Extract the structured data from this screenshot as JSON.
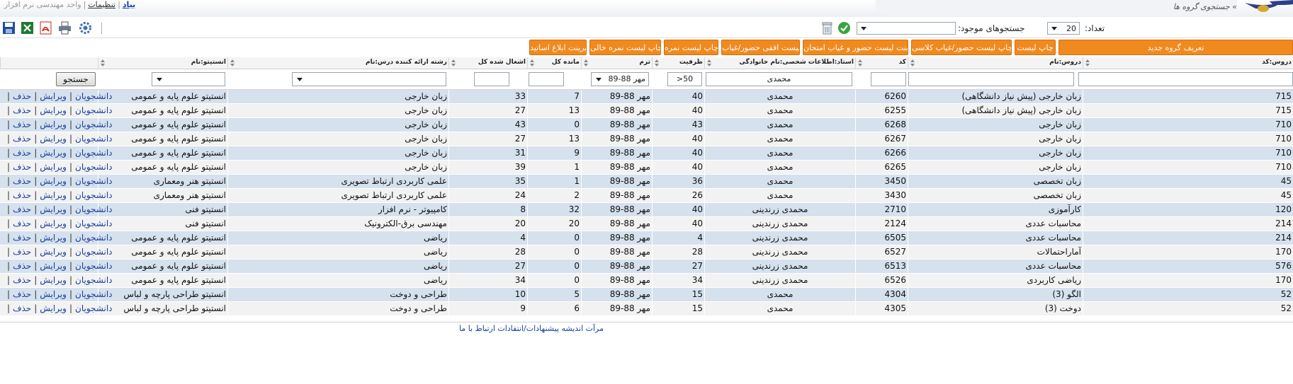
{
  "header": {
    "link_cut": "بیاد",
    "link_settings": "تنظیمات",
    "separator": "|",
    "unit_name": "واحد مهندسی نرم افزار",
    "breadcrumb": "» جستجوی گروه ها"
  },
  "filters": {
    "count_label": "تعداد:",
    "count_value": "20",
    "saved_searches_label": "جستجوهای موجود:",
    "saved_searches_value": ""
  },
  "toolbar_icons": [
    "save-icon",
    "excel-icon",
    "pdf-icon",
    "print-icon",
    "settings-icon",
    "confirm-icon",
    "trash-icon"
  ],
  "buttons": [
    "تعریف گروه جدید",
    "چاپ لیست",
    "چاپ لیست حضور/غیاب کلاسی",
    "پرینت لیست حضور و غیاب امتحان",
    "لیست افقی حضور/غیاب",
    "چاپ لیست نمره",
    "چاپ لیست نمره خالی",
    "پرینت ابلاغ اساتید"
  ],
  "table": {
    "headers": {
      "course_code": "دروس:کد",
      "course_name": "دروس:نام",
      "code": "کد",
      "teacher": "استاد:اطلاعات شخصی:نام خانوادگی",
      "capacity": "ظرفیت",
      "term": "ترم",
      "remaining": "مانده کل",
      "enrolled": "اشغال شده کل",
      "field": "رشته ارائه کننده درس:نام",
      "institute": "انستیتو:نام"
    },
    "filter_row": {
      "teacher_value": "محمدی",
      "capacity_value": "50<",
      "term_value": "مهر 88-89",
      "search_button": "جستجو"
    },
    "action_labels": {
      "students": "دانشجویان",
      "edit": "ویرایش",
      "delete": "حذف",
      "separator": "|"
    },
    "rows": [
      {
        "course_code": "715",
        "course_name": "زبان خارجی (پیش نیاز دانشگاهی)",
        "code": "6260",
        "teacher": "محمدی",
        "capacity": "40",
        "term": "مهر 88-89",
        "remaining": "7",
        "enrolled": "33",
        "field": "زبان خارجی",
        "institute": "انستیتو علوم پایه و عمومی"
      },
      {
        "course_code": "715",
        "course_name": "زبان خارجی (پیش نیاز دانشگاهی)",
        "code": "6255",
        "teacher": "محمدی",
        "capacity": "40",
        "term": "مهر 88-89",
        "remaining": "13",
        "enrolled": "27",
        "field": "زبان خارجی",
        "institute": "انستیتو علوم پایه و عمومی"
      },
      {
        "course_code": "710",
        "course_name": "زبان خارجی",
        "code": "6268",
        "teacher": "محمدی",
        "capacity": "43",
        "term": "مهر 88-89",
        "remaining": "0",
        "enrolled": "43",
        "field": "زبان خارجی",
        "institute": "انستیتو علوم پایه و عمومی"
      },
      {
        "course_code": "710",
        "course_name": "زبان خارجی",
        "code": "6267",
        "teacher": "محمدی",
        "capacity": "40",
        "term": "مهر 88-89",
        "remaining": "13",
        "enrolled": "27",
        "field": "زبان خارجی",
        "institute": "انستیتو علوم پایه و عمومی"
      },
      {
        "course_code": "710",
        "course_name": "زبان خارجی",
        "code": "6266",
        "teacher": "محمدی",
        "capacity": "40",
        "term": "مهر 88-89",
        "remaining": "9",
        "enrolled": "31",
        "field": "زبان خارجی",
        "institute": "انستیتو علوم پایه و عمومی"
      },
      {
        "course_code": "710",
        "course_name": "زبان خارجی",
        "code": "6265",
        "teacher": "محمدی",
        "capacity": "40",
        "term": "مهر 88-89",
        "remaining": "1",
        "enrolled": "39",
        "field": "زبان خارجی",
        "institute": "انستیتو علوم پایه و عمومی"
      },
      {
        "course_code": "45",
        "course_name": "زبان تخصصی",
        "code": "3450",
        "teacher": "محمدی",
        "capacity": "36",
        "term": "مهر 88-89",
        "remaining": "1",
        "enrolled": "35",
        "field": "علمی کاربردی ارتباط تصویری",
        "institute": "انستیتو هنر ومعماری"
      },
      {
        "course_code": "45",
        "course_name": "زبان تخصصی",
        "code": "3430",
        "teacher": "محمدی",
        "capacity": "26",
        "term": "مهر 88-89",
        "remaining": "2",
        "enrolled": "24",
        "field": "علمی کاربردی ارتباط تصویری",
        "institute": "انستیتو هنر ومعماری"
      },
      {
        "course_code": "120",
        "course_name": "کارآموزی",
        "code": "2710",
        "teacher": "محمدی زرندینی",
        "capacity": "40",
        "term": "مهر 88-89",
        "remaining": "32",
        "enrolled": "8",
        "field": "کامپیوتر - نرم افزار",
        "institute": "انستیتو فنی"
      },
      {
        "course_code": "214",
        "course_name": "محاسبات عددی",
        "code": "2124",
        "teacher": "محمدی زرندینی",
        "capacity": "40",
        "term": "مهر 88-89",
        "remaining": "20",
        "enrolled": "20",
        "field": "مهندسی برق-الکترونیک",
        "institute": "انستیتو فنی"
      },
      {
        "course_code": "214",
        "course_name": "محاسبات عددی",
        "code": "6505",
        "teacher": "محمدی زرندینی",
        "capacity": "4",
        "term": "مهر 88-89",
        "remaining": "0",
        "enrolled": "4",
        "field": "ریاضی",
        "institute": "انستیتو علوم پایه و عمومی"
      },
      {
        "course_code": "170",
        "course_name": "آماراحتمالات",
        "code": "6527",
        "teacher": "محمدی زرندینی",
        "capacity": "28",
        "term": "مهر 88-89",
        "remaining": "0",
        "enrolled": "28",
        "field": "ریاضی",
        "institute": "انستیتو علوم پایه و عمومی"
      },
      {
        "course_code": "576",
        "course_name": "محاسبات عددی",
        "code": "6513",
        "teacher": "محمدی زرندینی",
        "capacity": "27",
        "term": "مهر 88-89",
        "remaining": "0",
        "enrolled": "27",
        "field": "ریاضی",
        "institute": "انستیتو علوم پایه و عمومی"
      },
      {
        "course_code": "170",
        "course_name": "ریاضی کاربردی",
        "code": "6526",
        "teacher": "محمدی زرندینی",
        "capacity": "34",
        "term": "مهر 88-89",
        "remaining": "0",
        "enrolled": "34",
        "field": "ریاضی",
        "institute": "انستیتو علوم پایه و عمومی"
      },
      {
        "course_code": "52",
        "course_name": "الگو (3)",
        "code": "4304",
        "teacher": "محمدی",
        "capacity": "15",
        "term": "مهر 88-89",
        "remaining": "5",
        "enrolled": "10",
        "field": "طراحی و دوخت",
        "institute": "انستیتو طراحی پارچه و لباس"
      },
      {
        "course_code": "52",
        "course_name": "دوخت (3)",
        "code": "4305",
        "teacher": "محمدی",
        "capacity": "15",
        "term": "مهر 88-89",
        "remaining": "6",
        "enrolled": "9",
        "field": "طراحی و دوخت",
        "institute": "انستیتو طراحی پارچه و لباس"
      }
    ]
  },
  "footer": {
    "links": "مرآت اندیشه پیشنهادات/انتقادات ارتباط با ما"
  }
}
